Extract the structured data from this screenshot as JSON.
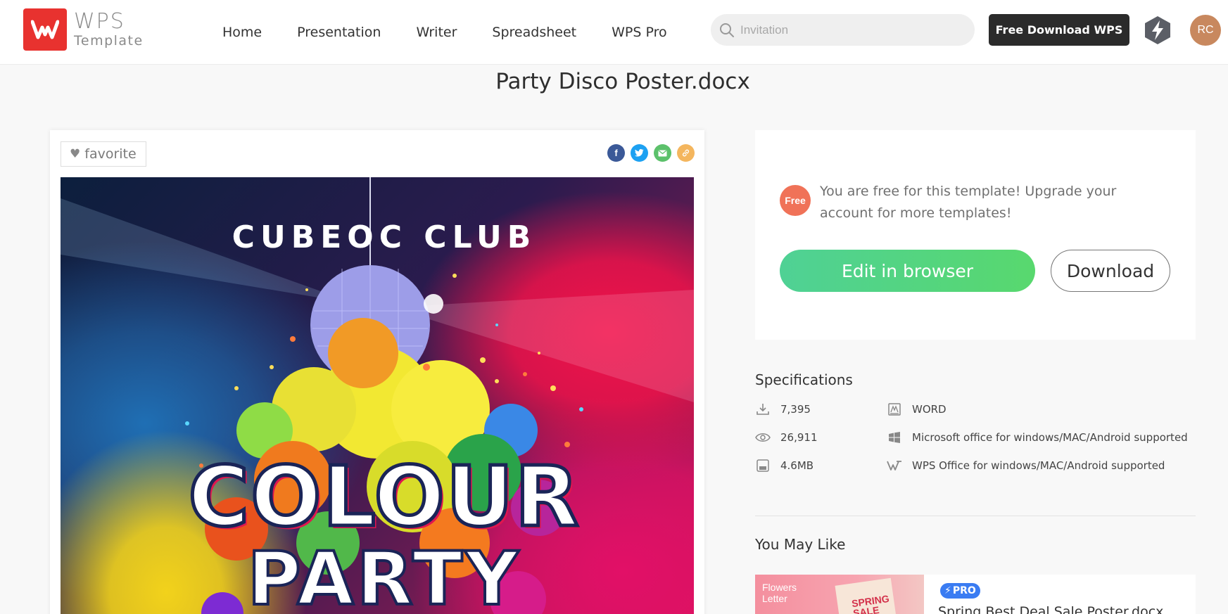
{
  "header": {
    "logo": {
      "brand": "WPS",
      "sub": "Template"
    },
    "nav": [
      "Home",
      "Presentation",
      "Writer",
      "Spreadsheet",
      "WPS Pro"
    ],
    "search": {
      "placeholder": "Invitation"
    },
    "cta": "Free Download WPS",
    "avatar_initials": "RC"
  },
  "page": {
    "title": "Party Disco Poster.docx"
  },
  "preview": {
    "favorite_label": "favorite",
    "share_icons": [
      "facebook-icon",
      "twitter-icon",
      "email-icon",
      "link-icon"
    ],
    "share_colors": [
      "#3b5998",
      "#1da1f2",
      "#5cc16b",
      "#f4b65e"
    ],
    "poster": {
      "club": "CUBEOC CLUB",
      "headline": "COLOUR",
      "subheadline": "PARTY"
    }
  },
  "free_panel": {
    "badge": "Free",
    "message": "You are free for this template! Upgrade your account for more templates!",
    "edit_label": "Edit in browser",
    "download_label": "Download",
    "accent": "#52d583"
  },
  "specs": {
    "title": "Specifications",
    "downloads": "7,395",
    "views": "26,911",
    "size": "4.6MB",
    "format": "WORD",
    "ms_support": "Microsoft office for windows/MAC/Android supported",
    "wps_support": "WPS Office for windows/MAC/Android supported"
  },
  "you_may_like": {
    "title": "You May Like",
    "items": [
      {
        "thumb_text": "Flowers Letter",
        "thumb_badge": "SPRING SALE",
        "badge": "PRO",
        "name": "Spring Best Deal Sale Poster.docx"
      }
    ]
  }
}
